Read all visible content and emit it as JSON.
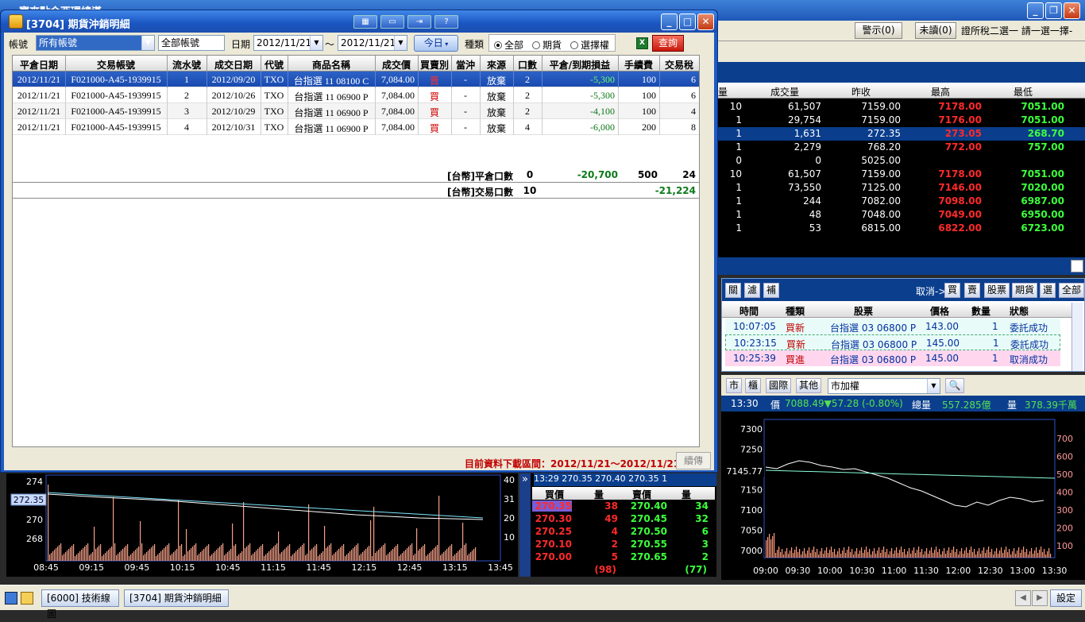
{
  "app": {
    "title": "寶來點金西環總導",
    "toolbar": {
      "alert_label": "警示(0)",
      "unread_label": "未讀(0)",
      "right_text": "證所稅二選一 請一選一擇-"
    }
  },
  "quote_table": {
    "columns": [
      "量",
      "成交量",
      "昨收",
      "最高",
      "最低"
    ],
    "rows": [
      {
        "qty": "10",
        "volume": "61,507",
        "prev": "7159.00",
        "high": "7178.00",
        "low": "7051.00"
      },
      {
        "qty": "1",
        "volume": "29,754",
        "prev": "7159.00",
        "high": "7176.00",
        "low": "7051.00"
      },
      {
        "qty": "1",
        "volume": "1,631",
        "prev": "272.35",
        "high": "273.05",
        "low": "268.70"
      },
      {
        "qty": "1",
        "volume": "2,279",
        "prev": "768.20",
        "high": "772.00",
        "low": "757.00"
      },
      {
        "qty": "0",
        "volume": "0",
        "prev": "5025.00",
        "high": "",
        "low": ""
      },
      {
        "qty": "10",
        "volume": "61,507",
        "prev": "7159.00",
        "high": "7178.00",
        "low": "7051.00"
      },
      {
        "qty": "1",
        "volume": "73,550",
        "prev": "7125.00",
        "high": "7146.00",
        "low": "7020.00"
      },
      {
        "qty": "1",
        "volume": "244",
        "prev": "7082.00",
        "high": "7098.00",
        "low": "6987.00"
      },
      {
        "qty": "1",
        "volume": "48",
        "prev": "7048.00",
        "high": "7049.00",
        "low": "6950.00"
      },
      {
        "qty": "1",
        "volume": "53",
        "prev": "6815.00",
        "high": "6822.00",
        "low": "6723.00"
      }
    ]
  },
  "orders": {
    "buttons": [
      "關",
      "濾",
      "補"
    ],
    "cancel_label": "取消->",
    "cancel_buttons": [
      "買",
      "賣",
      "股票",
      "期貨",
      "選",
      "全部"
    ],
    "columns": [
      "時間",
      "種類",
      "股票",
      "價格",
      "數量",
      "狀態"
    ],
    "rows": [
      {
        "time": "10:07:05",
        "kind": "買新",
        "stock": "台指選 03 06800 P",
        "price": "143.00",
        "qty": "1",
        "status": "委託成功"
      },
      {
        "time": "10:23:15",
        "kind": "買新",
        "stock": "台指選 03 06800 P",
        "price": "145.00",
        "qty": "1",
        "status": "委託成功"
      },
      {
        "time": "10:25:39",
        "kind": "買進",
        "stock": "台指選 03 06800 P",
        "price": "145.00",
        "qty": "1",
        "status": "取消成功"
      }
    ]
  },
  "index_panel": {
    "tabs": [
      "市",
      "櫃",
      "國際",
      "其他"
    ],
    "market_select": "市加權",
    "time": "13:30",
    "price_label": "價",
    "price_value": "7088.49▼57.28 (-0.80%)",
    "volume_label": "總量",
    "volume_value": "557.285億",
    "qty_label": "量",
    "qty_value": "378.39千萬",
    "marker_value": "7145.77",
    "y_labels": [
      "7300",
      "7250",
      "7200",
      "7150",
      "7100",
      "7050",
      "7000"
    ],
    "y2_labels": [
      "700",
      "600",
      "500",
      "400",
      "300",
      "200",
      "100"
    ],
    "x_labels": [
      "09:00",
      "09:30",
      "10:00",
      "10:30",
      "11:00",
      "11:30",
      "12:00",
      "12:30",
      "13:00",
      "13:30"
    ]
  },
  "left_chart": {
    "marker_value": "272.35",
    "y_labels": [
      "274",
      "270",
      "268"
    ],
    "y2_labels": [
      "40",
      "31",
      "20",
      "10"
    ],
    "x_labels": [
      "08:45",
      "09:15",
      "09:45",
      "10:15",
      "10:45",
      "11:15",
      "11:45",
      "12:15",
      "12:45",
      "13:15",
      "13:45"
    ]
  },
  "order_book": {
    "tick": "13:29   270.35   270.40   270.35   1",
    "columns": [
      "買價",
      "量",
      "賣價",
      "量"
    ],
    "rows": [
      {
        "bid": "270.35",
        "bid_qty": "38",
        "ask": "270.40",
        "ask_qty": "34"
      },
      {
        "bid": "270.30",
        "bid_qty": "49",
        "ask": "270.45",
        "ask_qty": "32"
      },
      {
        "bid": "270.25",
        "bid_qty": "4",
        "ask": "270.50",
        "ask_qty": "6"
      },
      {
        "bid": "270.10",
        "bid_qty": "2",
        "ask": "270.55",
        "ask_qty": "3"
      },
      {
        "bid": "270.00",
        "bid_qty": "5",
        "ask": "270.65",
        "ask_qty": "2"
      }
    ],
    "bid_total": "(98)",
    "ask_total": "(77)"
  },
  "taskbar": {
    "tasks": [
      "[6000] 技術線圖",
      "[3704] 期貨沖銷明細"
    ],
    "settings_label": "設定"
  },
  "dialog": {
    "title": "[3704] 期貨沖銷明細",
    "account_label": "帳號",
    "account_value": "所有帳號",
    "account_text": "全部帳號",
    "date_label": "日期",
    "date_from": "2012/11/21",
    "date_sep": "～",
    "date_to": "2012/11/21",
    "today_button": "今日",
    "type_label": "種類",
    "type_options": [
      "全部",
      "期貨",
      "選擇權"
    ],
    "excel_label": "X",
    "query_button": "查詢",
    "columns": [
      "平倉日期",
      "交易帳號",
      "流水號",
      "成交日期",
      "代號",
      "商品名稱",
      "成交價",
      "買賣別",
      "當沖",
      "來源",
      "口數",
      "平倉/到期損益",
      "手續費",
      "交易稅"
    ],
    "rows": [
      {
        "close_date": "2012/11/21",
        "account": "F021000-A45-1939915",
        "serial": "1",
        "trade_date": "2012/09/20",
        "code": "TXO",
        "product": "台指選 11 08100 C",
        "price": "7,084.00",
        "side": "賣",
        "daytrade": "-",
        "source": "放棄",
        "lots": "2",
        "pnl": "-5,300",
        "fee": "100",
        "tax": "6"
      },
      {
        "close_date": "2012/11/21",
        "account": "F021000-A45-1939915",
        "serial": "2",
        "trade_date": "2012/10/26",
        "code": "TXO",
        "product": "台指選 11 06900 P",
        "price": "7,084.00",
        "side": "買",
        "daytrade": "-",
        "source": "放棄",
        "lots": "2",
        "pnl": "-5,300",
        "fee": "100",
        "tax": "6"
      },
      {
        "close_date": "2012/11/21",
        "account": "F021000-A45-1939915",
        "serial": "3",
        "trade_date": "2012/10/29",
        "code": "TXO",
        "product": "台指選 11 06900 P",
        "price": "7,084.00",
        "side": "買",
        "daytrade": "-",
        "source": "放棄",
        "lots": "2",
        "pnl": "-4,100",
        "fee": "100",
        "tax": "4"
      },
      {
        "close_date": "2012/11/21",
        "account": "F021000-A45-1939915",
        "serial": "4",
        "trade_date": "2012/10/31",
        "code": "TXO",
        "product": "台指選 11 06900 P",
        "price": "7,084.00",
        "side": "買",
        "daytrade": "-",
        "source": "放棄",
        "lots": "4",
        "pnl": "-6,000",
        "fee": "200",
        "tax": "8"
      }
    ],
    "summary1": {
      "label": "[台幣]平倉口數",
      "lots": "0",
      "pnl": "-20,700",
      "fee": "500",
      "tax": "24"
    },
    "summary2": {
      "label": "[台幣]交易口數",
      "lots": "10",
      "total": "-21,224"
    },
    "range_text": "目前資料下載區間：2012/11/21～2012/11/21",
    "continue_button": "續傳"
  }
}
